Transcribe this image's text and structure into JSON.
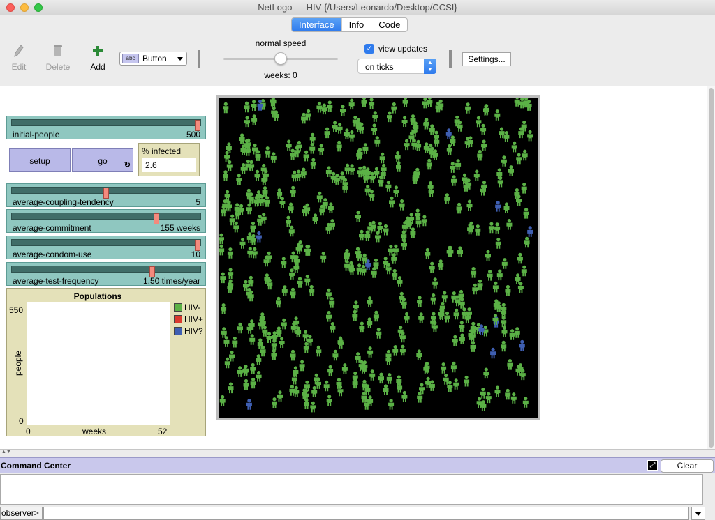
{
  "window": {
    "title": "NetLogo — HIV {/Users/Leonardo/Desktop/CCSI}"
  },
  "tabs": [
    {
      "label": "Interface"
    },
    {
      "label": "Info"
    },
    {
      "label": "Code"
    }
  ],
  "toolbar": {
    "edit_label": "Edit",
    "delete_label": "Delete",
    "add_label": "Add",
    "widget_type": "Button",
    "widget_type_icon": "abc",
    "speed_label": "normal speed",
    "speed_level": 0.5,
    "ticks_label": "weeks: 0",
    "view_updates_label": "view updates",
    "view_updates_checked": true,
    "update_mode": "on ticks",
    "settings_label": "Settings..."
  },
  "widgets": {
    "initial_people": {
      "name": "initial-people",
      "value": "500",
      "fraction": 1.0
    },
    "setup": {
      "label": "setup"
    },
    "go": {
      "label": "go",
      "forever_icon": "↻"
    },
    "percent_infected": {
      "name": "% infected",
      "value": "2.6"
    },
    "coupling": {
      "name": "average-coupling-tendency",
      "value": "5",
      "fraction": 0.5
    },
    "commitment": {
      "name": "average-commitment",
      "value": "155 weeks",
      "fraction": 0.775
    },
    "condom_use": {
      "name": "average-condom-use",
      "value": "10",
      "fraction": 1.0
    },
    "test_frequency": {
      "name": "average-test-frequency",
      "value": "1.50 times/year",
      "fraction": 0.75
    }
  },
  "plot": {
    "title": "Populations",
    "y_max": "550",
    "y_min": "0",
    "x_min": "0",
    "x_max": "52",
    "x_label": "weeks",
    "y_label": "people",
    "legend": [
      {
        "label": "HIV-",
        "color": "#5bb146"
      },
      {
        "label": "HIV+",
        "color": "#d93a2f"
      },
      {
        "label": "HIV?",
        "color": "#3f5fb2"
      }
    ]
  },
  "world": {
    "background": "#000000",
    "healthy_color": "#5bb146",
    "unknown_color": "#3f5fb2"
  },
  "command_center": {
    "title": "Command Center",
    "clear_label": "Clear",
    "prompt": "observer>"
  }
}
